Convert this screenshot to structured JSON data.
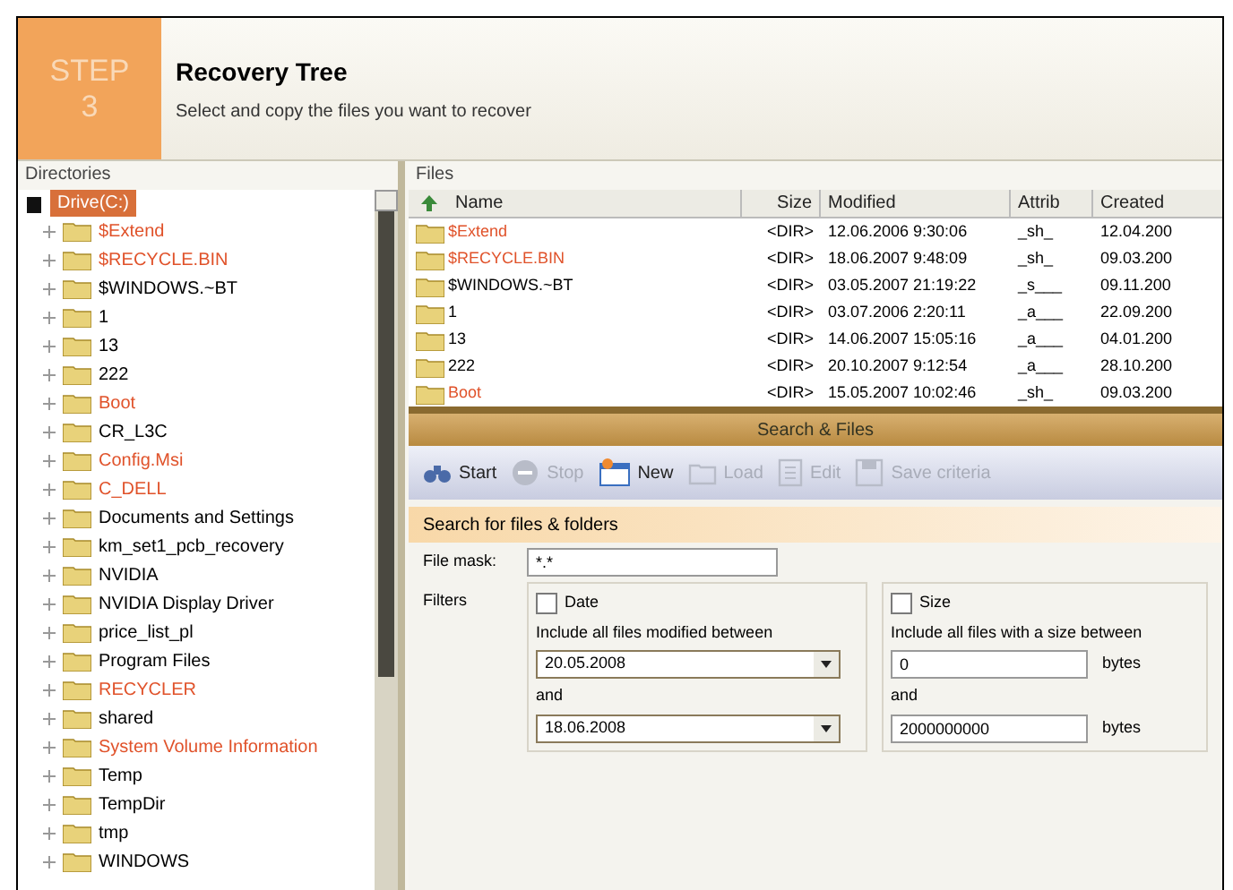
{
  "header": {
    "step_label": "STEP",
    "step_number": "3",
    "title": "Recovery Tree",
    "subtitle": "Select and copy the files you want to recover"
  },
  "directories": {
    "title": "Directories",
    "root": {
      "label": "Drive(C:)",
      "selected": true,
      "children": [
        {
          "label": "$Extend",
          "deleted": true
        },
        {
          "label": "$RECYCLE.BIN",
          "deleted": true
        },
        {
          "label": "$WINDOWS.~BT",
          "deleted": false
        },
        {
          "label": "1",
          "deleted": false
        },
        {
          "label": "13",
          "deleted": false
        },
        {
          "label": "222",
          "deleted": false
        },
        {
          "label": "Boot",
          "deleted": true
        },
        {
          "label": "CR_L3C",
          "deleted": false
        },
        {
          "label": "Config.Msi",
          "deleted": true
        },
        {
          "label": "C_DELL",
          "deleted": true
        },
        {
          "label": "Documents and Settings",
          "deleted": false
        },
        {
          "label": "km_set1_pcb_recovery",
          "deleted": false
        },
        {
          "label": "NVIDIA",
          "deleted": false
        },
        {
          "label": "NVIDIA Display Driver",
          "deleted": false
        },
        {
          "label": "price_list_pl",
          "deleted": false
        },
        {
          "label": "Program Files",
          "deleted": false
        },
        {
          "label": "RECYCLER",
          "deleted": true
        },
        {
          "label": "shared",
          "deleted": false
        },
        {
          "label": "System Volume Information",
          "deleted": true
        },
        {
          "label": "Temp",
          "deleted": false
        },
        {
          "label": "TempDir",
          "deleted": false
        },
        {
          "label": "tmp",
          "deleted": false
        },
        {
          "label": "WINDOWS",
          "deleted": false
        }
      ]
    }
  },
  "files": {
    "title": "Files",
    "columns": [
      "Name",
      "Size",
      "Modified",
      "Attrib",
      "Created"
    ],
    "rows": [
      {
        "name": "$Extend",
        "deleted": true,
        "size": "<DIR>",
        "modified": "12.06.2006 9:30:06",
        "attrib": "_sh_",
        "created": "12.04.200"
      },
      {
        "name": "$RECYCLE.BIN",
        "deleted": true,
        "size": "<DIR>",
        "modified": "18.06.2007 9:48:09",
        "attrib": "_sh_",
        "created": "09.03.200"
      },
      {
        "name": "$WINDOWS.~BT",
        "deleted": false,
        "size": "<DIR>",
        "modified": "03.05.2007 21:19:22",
        "attrib": "_s___",
        "created": "09.11.200"
      },
      {
        "name": "1",
        "deleted": false,
        "size": "<DIR>",
        "modified": "03.07.2006 2:20:11",
        "attrib": "_a___",
        "created": "22.09.200"
      },
      {
        "name": "13",
        "deleted": false,
        "size": "<DIR>",
        "modified": "14.06.2007 15:05:16",
        "attrib": "_a___",
        "created": "04.01.200"
      },
      {
        "name": "222",
        "deleted": false,
        "size": "<DIR>",
        "modified": "20.10.2007 9:12:54",
        "attrib": "_a___",
        "created": "28.10.200"
      },
      {
        "name": "Boot",
        "deleted": true,
        "size": "<DIR>",
        "modified": "15.05.2007 10:02:46",
        "attrib": "_sh_",
        "created": "09.03.200"
      }
    ]
  },
  "search_dialog": {
    "title": "Search & Files",
    "toolbar": [
      {
        "label": "Start",
        "disabled": false,
        "kind": "start"
      },
      {
        "label": "Stop",
        "disabled": true,
        "kind": "stop"
      },
      {
        "label": "New",
        "disabled": false,
        "kind": "new"
      },
      {
        "label": "Load",
        "disabled": true,
        "kind": "load"
      },
      {
        "label": "Edit",
        "disabled": true,
        "kind": "edit"
      },
      {
        "label": "Save criteria",
        "disabled": true,
        "kind": "save"
      }
    ],
    "section_title": "Search for files & folders",
    "file_mask": {
      "label": "File mask:",
      "value": "*.*"
    },
    "filters_label": "Filters",
    "date_filter": {
      "label": "Date",
      "checked": false,
      "caption": "Include all files modified between",
      "from": "20.05.2008",
      "and_label": "and",
      "to": "18.06.2008"
    },
    "size_filter": {
      "label": "Size",
      "checked": false,
      "caption": "Include all files with a size between",
      "from": "0",
      "from_unit": "bytes",
      "and_label": "and",
      "to": "2000000000",
      "to_unit": "bytes"
    }
  }
}
